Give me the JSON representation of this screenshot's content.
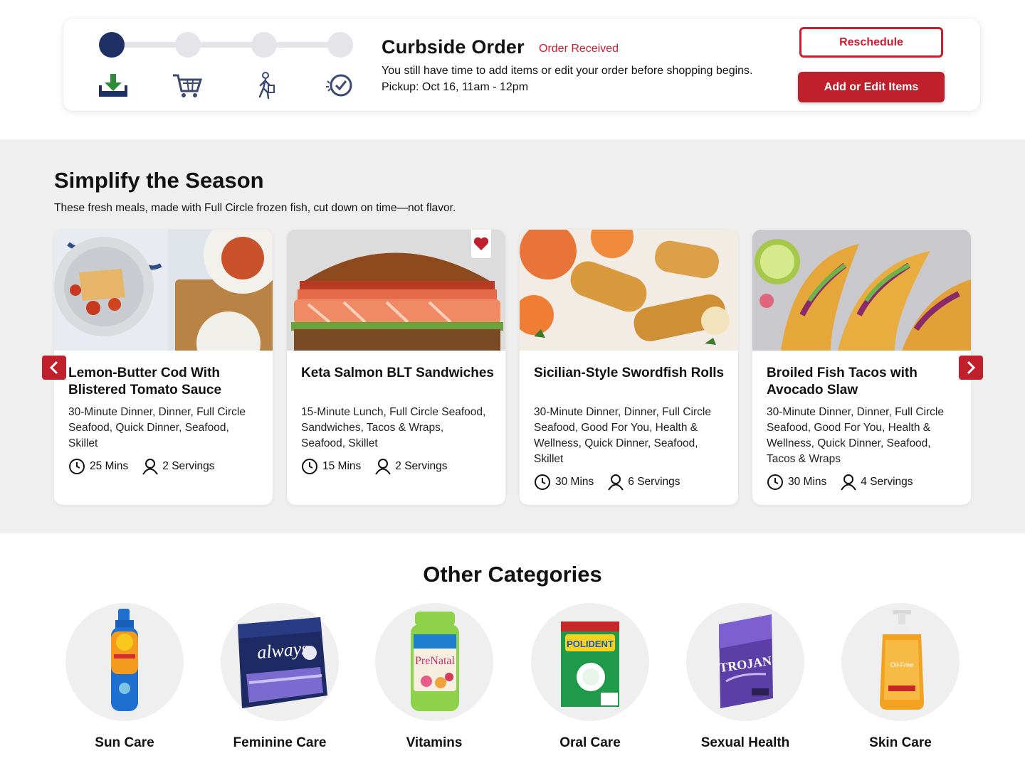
{
  "order": {
    "title": "Curbside Order",
    "status": "Order Received",
    "message": "You still have time to add items or edit your order before shopping begins.",
    "pickup": "Pickup: Oct 16, 11am - 12pm",
    "reschedule_label": "Reschedule",
    "add_edit_label": "Add or Edit Items",
    "progress": {
      "current_step": 1,
      "total_steps": 4
    },
    "steps": [
      {
        "icon": "download-tray-icon"
      },
      {
        "icon": "shopping-cart-icon"
      },
      {
        "icon": "walking-shopper-icon"
      },
      {
        "icon": "check-badge-icon"
      }
    ]
  },
  "season": {
    "title": "Simplify the Season",
    "subtitle": "These fresh meals, made with Full Circle frozen fish, cut down on time—not flavor.",
    "recipes": [
      {
        "title": "Lemon-Butter Cod With Blistered Tomato Sauce",
        "tags": "30-Minute Dinner, Dinner, Full Circle Seafood, Quick Dinner, Seafood, Skillet",
        "time": "25 Mins",
        "servings": "2 Servings",
        "favorited": false
      },
      {
        "title": "Keta Salmon BLT Sandwiches",
        "tags": "15-Minute Lunch, Full Circle Seafood, Sandwiches, Tacos & Wraps, Seafood, Skillet",
        "time": "15 Mins",
        "servings": "2 Servings",
        "favorited": true
      },
      {
        "title": "Sicilian-Style Swordfish Rolls",
        "tags": "30-Minute Dinner, Dinner, Full Circle Seafood, Good For You, Health & Wellness, Quick Dinner, Seafood, Skillet",
        "time": "30 Mins",
        "servings": "6 Servings",
        "favorited": false
      },
      {
        "title": "Broiled Fish Tacos with Avocado Slaw",
        "tags": "30-Minute Dinner, Dinner, Full Circle Seafood, Good For You, Health & Wellness, Quick Dinner, Seafood, Tacos & Wraps",
        "time": "30 Mins",
        "servings": "4 Servings",
        "favorited": false
      }
    ]
  },
  "categories": {
    "title": "Other Categories",
    "items": [
      {
        "label": "Sun Care"
      },
      {
        "label": "Feminine Care"
      },
      {
        "label": "Vitamins"
      },
      {
        "label": "Oral Care"
      },
      {
        "label": "Sexual Health"
      },
      {
        "label": "Skin Care"
      }
    ]
  },
  "colors": {
    "brand_red": "#c0202c",
    "navy": "#1f3064",
    "panel_gray": "#efefef",
    "step_green": "#2e8b3a"
  }
}
